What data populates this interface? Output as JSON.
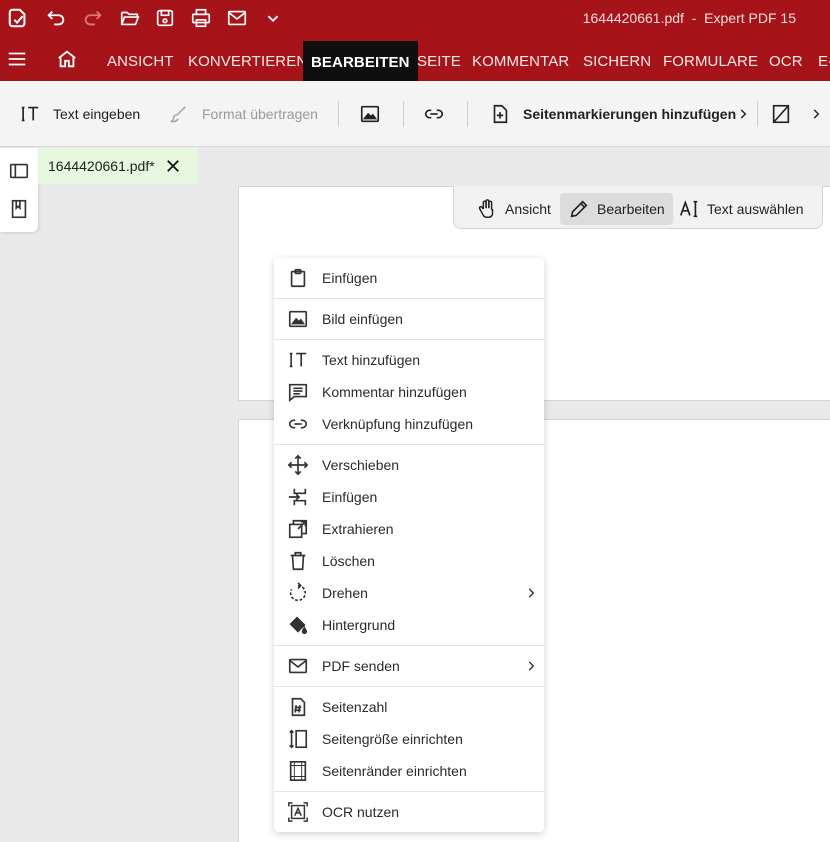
{
  "title_bar": {
    "filename": "1644420661.pdf",
    "separator": "-",
    "app_name": "Expert PDF 15",
    "icons": [
      "app-logo-icon",
      "undo-icon",
      "redo-icon",
      "open-folder-icon",
      "save-icon",
      "print-icon",
      "email-icon",
      "chevron-down-icon"
    ]
  },
  "ribbon": {
    "tabs": [
      "ANSICHT",
      "KONVERTIEREN",
      "BEARBEITEN",
      "SEITE",
      "KOMMENTAR",
      "SICHERN",
      "FORMULARE",
      "OCR",
      "E-"
    ],
    "active_tab": "BEARBEITEN"
  },
  "toolbar": {
    "text_input": "Text eingeben",
    "format_transfer": "Format übertragen",
    "add_page_marks": "Seitenmarkierungen hinzufügen"
  },
  "doc_tab": {
    "label": "1644420661.pdf*"
  },
  "modes": {
    "view": "Ansicht",
    "edit": "Bearbeiten",
    "select_text": "Text auswählen",
    "active": "Bearbeiten"
  },
  "context_menu": {
    "items": [
      {
        "label": "Einfügen",
        "icon": "clipboard-icon"
      },
      {
        "label": "Bild einfügen",
        "icon": "image-icon"
      },
      {
        "label": "Text hinzufügen",
        "icon": "text-icon"
      },
      {
        "label": "Kommentar hinzufügen",
        "icon": "comment-icon"
      },
      {
        "label": "Verknüpfung hinzufügen",
        "icon": "link-icon"
      },
      {
        "label": "Verschieben",
        "icon": "move-icon"
      },
      {
        "label": "Einfügen",
        "icon": "insert-page-icon"
      },
      {
        "label": "Extrahieren",
        "icon": "extract-icon"
      },
      {
        "label": "Löschen",
        "icon": "trash-icon"
      },
      {
        "label": "Drehen",
        "icon": "rotate-icon",
        "submenu": true
      },
      {
        "label": "Hintergrund",
        "icon": "paint-bucket-icon"
      },
      {
        "label": "PDF senden",
        "icon": "email-icon",
        "submenu": true
      },
      {
        "label": "Seitenzahl",
        "icon": "page-number-icon"
      },
      {
        "label": "Seitengröße einrichten",
        "icon": "page-size-icon"
      },
      {
        "label": "Seitenränder einrichten",
        "icon": "page-margins-icon"
      },
      {
        "label": "OCR nutzen",
        "icon": "ocr-icon"
      }
    ]
  },
  "colors": {
    "accent": "#a6141a",
    "active_tab_bg": "#0f0f0f",
    "doc_tab_bg": "#e7f7df"
  }
}
